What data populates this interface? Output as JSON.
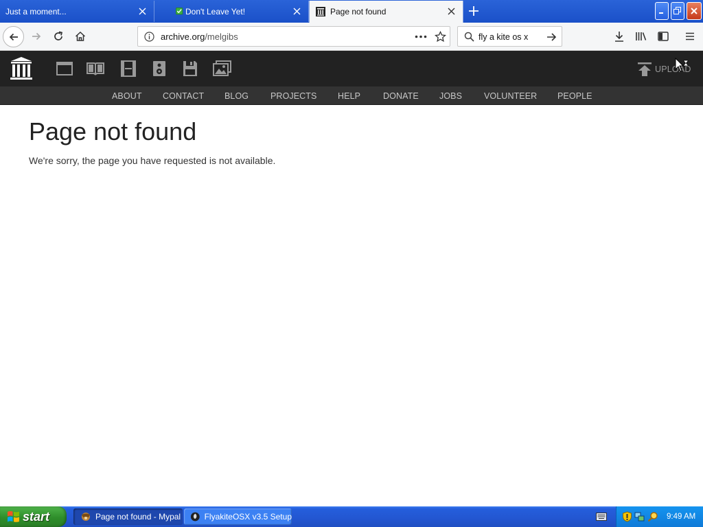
{
  "browser": {
    "tabs": [
      {
        "title": "Just a moment...",
        "active": false
      },
      {
        "title": "Don't Leave Yet!",
        "active": false
      },
      {
        "title": "Page not found",
        "active": true
      }
    ],
    "url_domain": "archive.org",
    "url_path": "/melgibs",
    "search_value": "fly a kite os x",
    "search_placeholder": "Search"
  },
  "site": {
    "upload_label": "UPLOAD",
    "nav": [
      "ABOUT",
      "CONTACT",
      "BLOG",
      "PROJECTS",
      "HELP",
      "DONATE",
      "JOBS",
      "VOLUNTEER",
      "PEOPLE"
    ],
    "media_icons": [
      "web-icon",
      "texts-icon",
      "video-icon",
      "audio-icon",
      "software-icon",
      "images-icon"
    ]
  },
  "content": {
    "heading": "Page not found",
    "message": "We're sorry, the page you have requested is not available."
  },
  "taskbar": {
    "start_label": "start",
    "items": [
      {
        "label": "Page not found - Mypal",
        "active": true
      },
      {
        "label": "FlyakiteOSX v3.5 Setup",
        "active": false
      }
    ],
    "clock": "9:49 AM"
  },
  "colors": {
    "titlebar": "#2a63d8",
    "site_header": "#222222",
    "site_subnav": "#333333",
    "taskbar": "#245edb",
    "start_button": "#3a9b35"
  }
}
